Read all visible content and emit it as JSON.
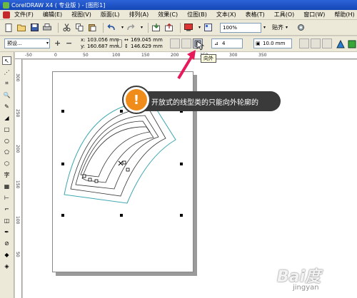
{
  "window": {
    "title": "CorelDRAW X4 ( 专业版 ) - [图形1]"
  },
  "menu": [
    "文件(F)",
    "编辑(E)",
    "视图(V)",
    "版面(L)",
    "排列(A)",
    "效果(C)",
    "位图(B)",
    "文本(X)",
    "表格(T)",
    "工具(O)",
    "窗口(W)",
    "帮助(H)"
  ],
  "toolbar": {
    "zoom_value": "100%",
    "snap_label": "贴齐"
  },
  "property_bar": {
    "preset_value": "预设...",
    "x_label": "x:",
    "x_value": "103.056 mm",
    "y_label": "y:",
    "y_value": "160.687 mm",
    "w_value": "169.045 mm",
    "h_value": "146.629 mm",
    "steps_value": "4",
    "offset_value": "10.0 mm",
    "tooltip": "向外"
  },
  "rulers": {
    "h_ticks": [
      "-50",
      "0",
      "50",
      "100",
      "150",
      "200",
      "250",
      "300",
      "350"
    ],
    "v_ticks": [
      "300",
      "250",
      "200",
      "150",
      "100",
      "50"
    ]
  },
  "callout": {
    "badge": "!",
    "text": "开放式的线型类的只能向外轮廓的"
  },
  "watermark": {
    "main": "Bai度",
    "sub": "jingyan"
  },
  "colors": {
    "contour": "#3aa6b0",
    "title_bar": "#1e54c4",
    "callout_bg": "#3a3a3a",
    "badge": "#f08c1a"
  }
}
